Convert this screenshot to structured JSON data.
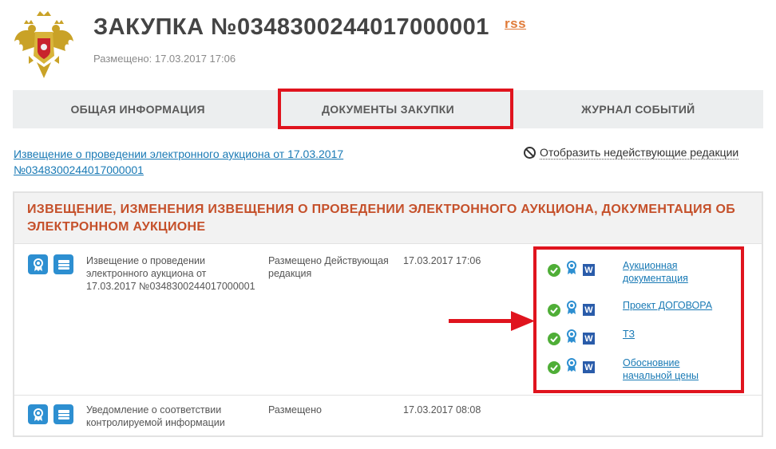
{
  "header": {
    "title": "ЗАКУПКА №0348300244017000001",
    "rss_label": "rss",
    "posted": "Размещено: 17.03.2017 17:06"
  },
  "tabs": [
    {
      "label": "ОБЩАЯ ИНФОРМАЦИЯ",
      "active": false
    },
    {
      "label": "ДОКУМЕНТЫ ЗАКУПКИ",
      "active": true
    },
    {
      "label": "ЖУРНАЛ СОБЫТИЙ",
      "active": false
    }
  ],
  "notice_link": "Извещение о проведении электронного аукциона от 17.03.2017 №0348300244017000001",
  "show_inactive": "Отобразить недействующие редакции",
  "panel": {
    "title": "ИЗВЕЩЕНИЕ, ИЗМЕНЕНИЯ ИЗВЕЩЕНИЯ О ПРОВЕДЕНИИ ЭЛЕКТРОННОГО АУКЦИОНА, ДОКУМЕНТАЦИЯ ОБ ЭЛЕКТРОННОМ АУКЦИОНЕ",
    "rows": [
      {
        "name": "Извещение о проведении электронного аукциона от 17.03.2017 №0348300244017000001",
        "status": "Размещено Действующая редакция",
        "date": "17.03.2017 17:06",
        "documents": [
          {
            "label": "Аукционная документация"
          },
          {
            "label": "Проект ДОГОВОРА"
          },
          {
            "label": "ТЗ"
          },
          {
            "label": "Обосновние начальной цены"
          }
        ]
      },
      {
        "name": "Уведомление о соответствии контролируемой информации",
        "status": "Размещено",
        "date": "17.03.2017 08:08"
      }
    ]
  },
  "icons": {
    "word": "W"
  },
  "colors": {
    "accent": "#c5502a",
    "link": "#1a7ab5",
    "highlight": "#e0141e",
    "icon_blue": "#2d8fd1",
    "ok_green": "#4fae37",
    "rss_orange": "#e07b39"
  }
}
